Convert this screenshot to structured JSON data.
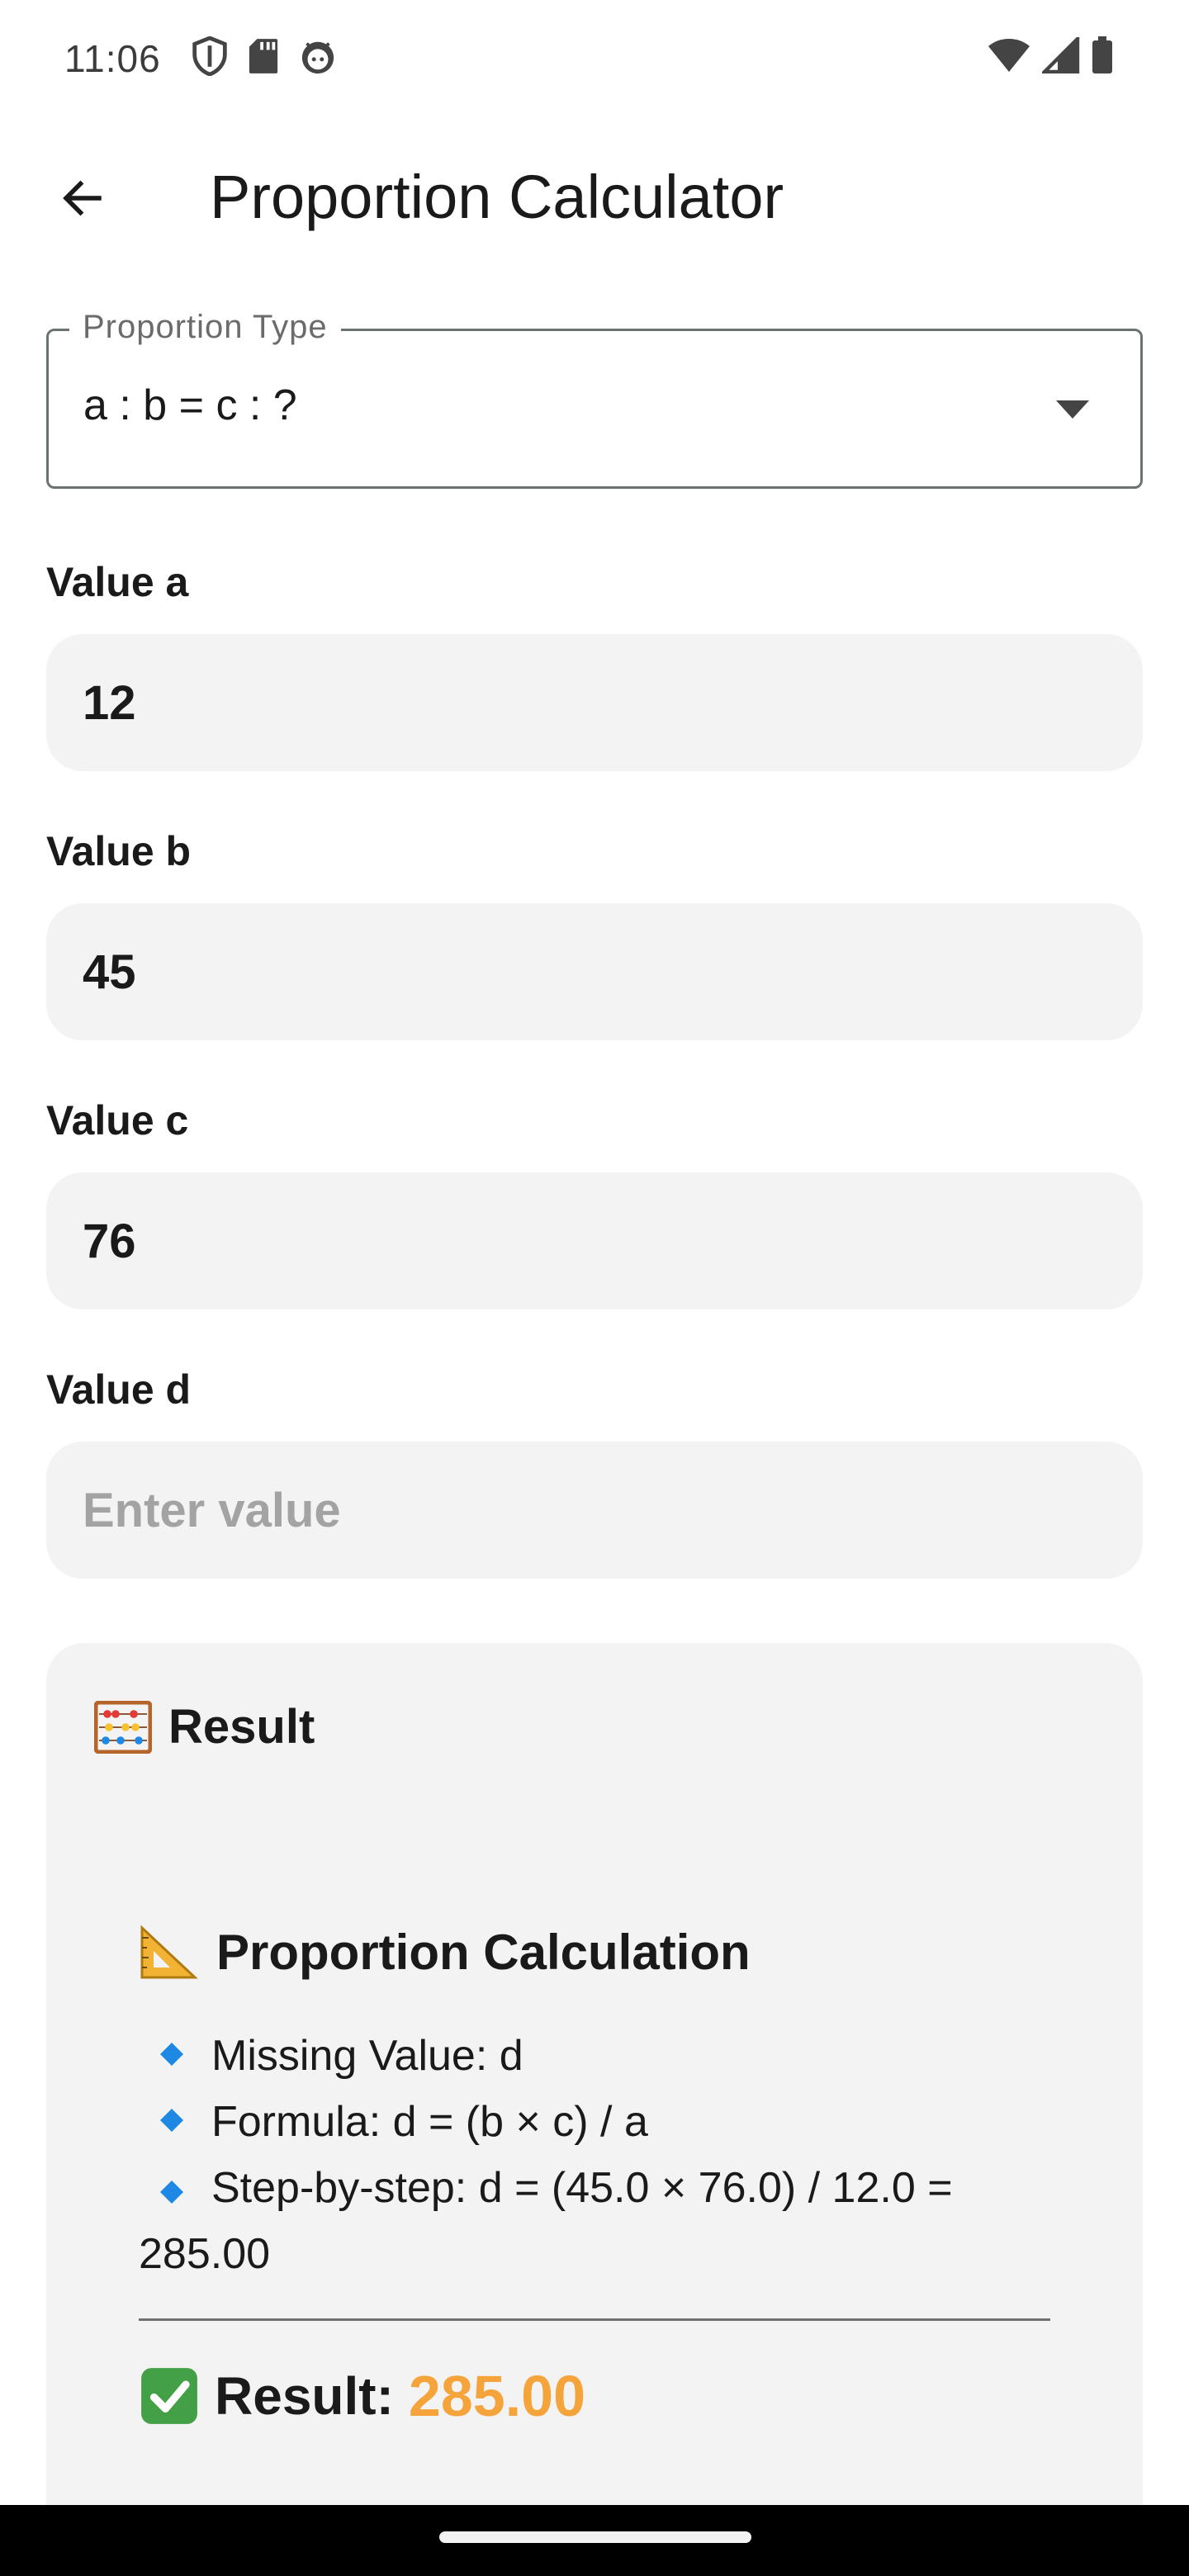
{
  "status_bar": {
    "time": "11:06",
    "left_icons": [
      "shield-icon",
      "sd-card-icon",
      "android-face-icon"
    ],
    "right_icons": [
      "wifi-icon",
      "signal-icon",
      "battery-icon"
    ]
  },
  "app_bar": {
    "title": "Proportion Calculator",
    "back_icon": "arrow-back-icon"
  },
  "proportion_type": {
    "label": "Proportion Type",
    "selected": "a : b = c : ?"
  },
  "fields": {
    "a": {
      "label": "Value a",
      "value": "12"
    },
    "b": {
      "label": "Value b",
      "value": "45"
    },
    "c": {
      "label": "Value c",
      "value": "76"
    },
    "d": {
      "label": "Value d",
      "value": "",
      "placeholder": "Enter value"
    }
  },
  "result": {
    "title": "Result",
    "title_icon": "abacus-icon",
    "calc_title": "Proportion Calculation",
    "calc_icon": "triangle-ruler-icon",
    "lines": [
      "Missing Value: d",
      "Formula: d = (b × c) / a",
      "Step-by-step: d = (45.0 × 76.0) / 12.0 = 285.00"
    ],
    "final_label": "Result:",
    "final_value": "285.00",
    "final_icon": "check-mark-icon"
  },
  "colors": {
    "accent": "#f5a33b",
    "input_bg": "#f3f3f3",
    "diamond": "#1e88e5"
  }
}
